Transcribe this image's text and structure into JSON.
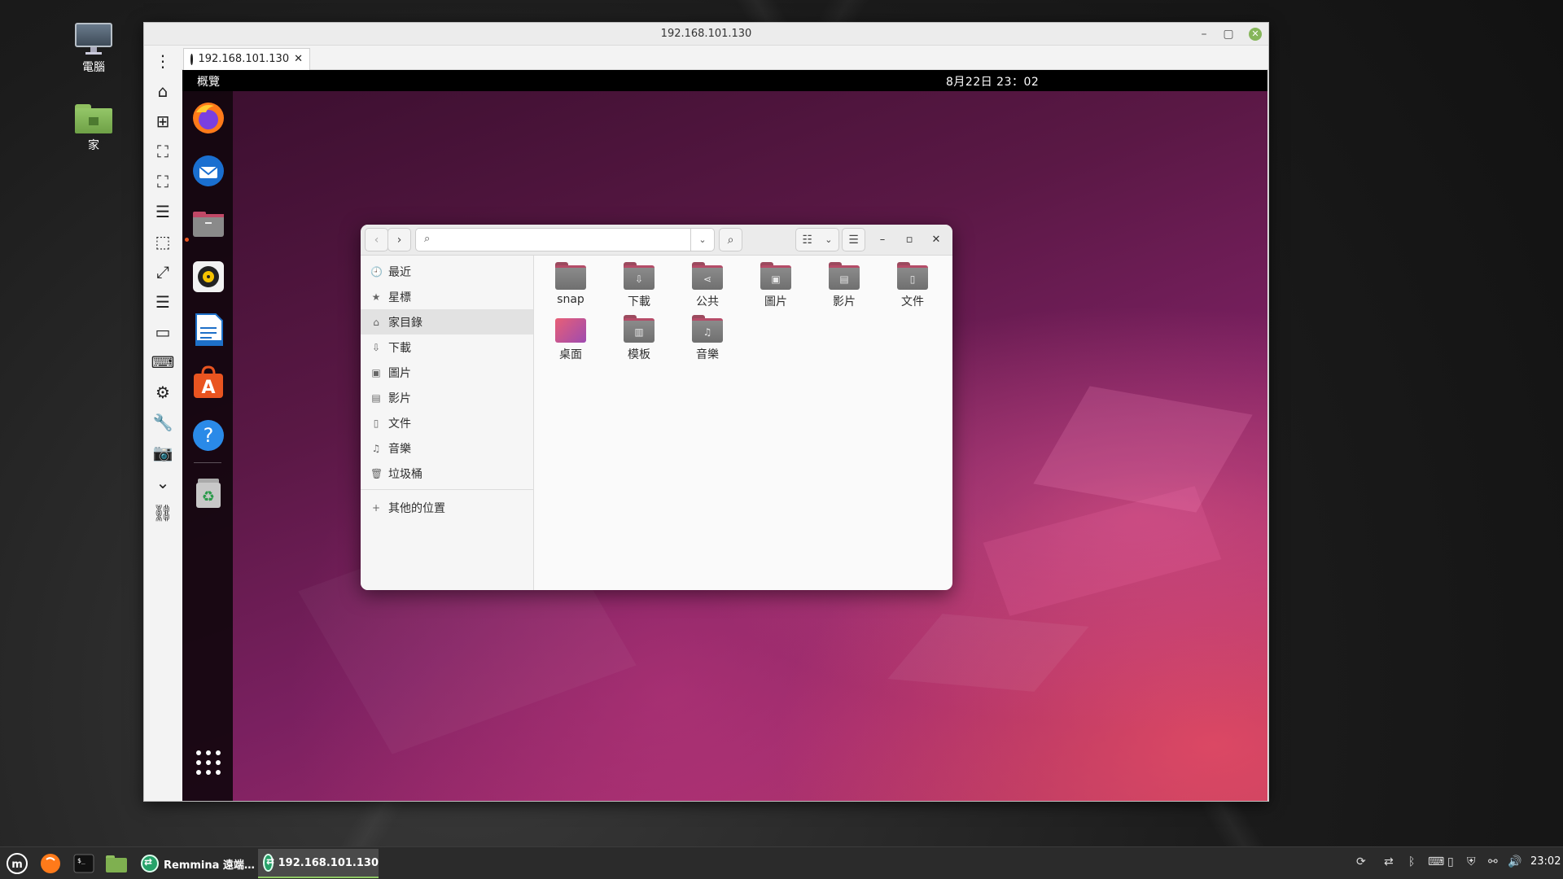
{
  "desktop": {
    "icons": [
      {
        "label": "電腦"
      },
      {
        "label": "家"
      }
    ]
  },
  "remmina": {
    "window_title": "192.168.101.130",
    "controls": {
      "minimize": "–",
      "maximize": "▢",
      "close": "✕"
    },
    "tab": {
      "label": "192.168.101.130",
      "close": "✕"
    },
    "toolbar": [
      "menu-icon",
      "home-icon",
      "new-connection-icon",
      "fit-window-icon",
      "fullscreen-icon",
      "toggle-menu-icon",
      "dynamic-resolution-icon",
      "scaled-mode-icon",
      "multi-monitor-icon",
      "switch-tab-icon",
      "keyboard-grab-icon",
      "preferences-icon",
      "tools-icon",
      "screenshot-icon",
      "minimize-icon",
      "disconnect-icon"
    ]
  },
  "remote": {
    "topbar": {
      "activities": "概覽",
      "clock": "8月22日  23：02"
    },
    "dock": [
      "firefox-icon",
      "thunderbird-icon",
      "files-icon",
      "rhythmbox-icon",
      "writer-icon",
      "app-center-icon",
      "help-icon",
      "trash-icon",
      "show-apps-icon"
    ],
    "files_window": {
      "sidebar": [
        {
          "icon": "🕘",
          "label": "最近"
        },
        {
          "icon": "★",
          "label": "星標"
        },
        {
          "icon": "⌂",
          "label": "家目錄"
        },
        {
          "icon": "⇩",
          "label": "下載"
        },
        {
          "icon": "▣",
          "label": "圖片"
        },
        {
          "icon": "▤",
          "label": "影片"
        },
        {
          "icon": "▯",
          "label": "文件"
        },
        {
          "icon": "♫",
          "label": "音樂"
        },
        {
          "icon": "🗑",
          "label": "垃圾桶"
        },
        {
          "icon": "+",
          "label": "其他的位置"
        }
      ],
      "items": [
        {
          "label": "snap",
          "glyph": ""
        },
        {
          "label": "下載",
          "glyph": "⇩"
        },
        {
          "label": "公共",
          "glyph": "⋖"
        },
        {
          "label": "圖片",
          "glyph": "▣"
        },
        {
          "label": "影片",
          "glyph": "▤"
        },
        {
          "label": "文件",
          "glyph": "▯"
        },
        {
          "label": "桌面",
          "glyph": ""
        },
        {
          "label": "模板",
          "glyph": "▥"
        },
        {
          "label": "音樂",
          "glyph": "♫"
        }
      ]
    }
  },
  "taskbar": {
    "tasks": [
      {
        "label": "Remmina 遠端…"
      },
      {
        "label": "192.168.101.130"
      }
    ],
    "clock": "23:02"
  }
}
